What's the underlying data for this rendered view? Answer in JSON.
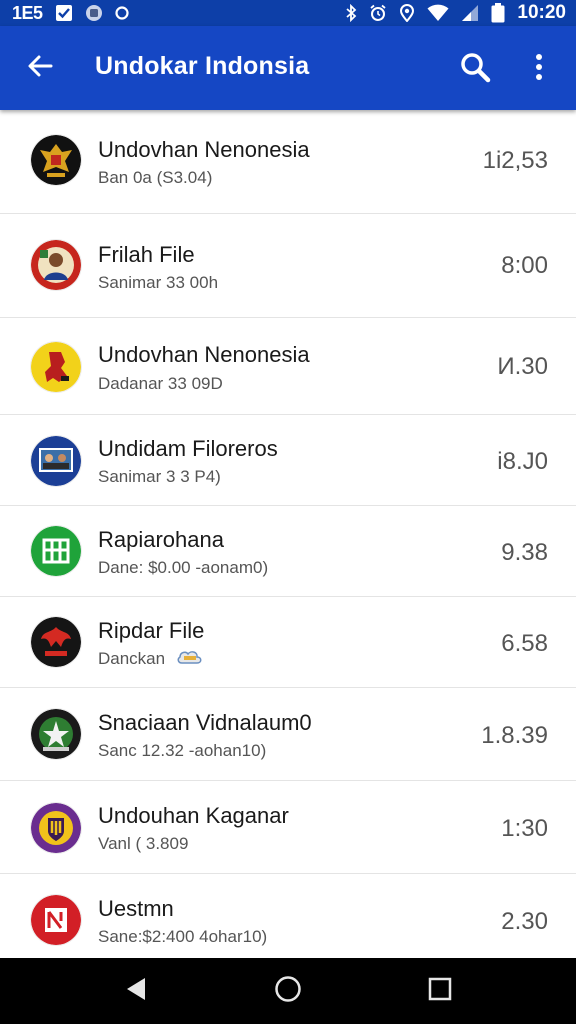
{
  "status_bar": {
    "left_time": "1E5",
    "clock": "10:20",
    "left_icons": [
      "checkbox-notification-icon",
      "app-notification-icon",
      "dot-notification-icon"
    ],
    "right_icons": [
      "bluetooth-icon",
      "alarm-icon",
      "location-icon",
      "wifi-icon",
      "signal-icon",
      "battery-icon"
    ]
  },
  "app_bar": {
    "title": "Undokar Indonsia",
    "back_icon": "arrow-back-icon",
    "search_icon": "search-icon",
    "more_icon": "more-vert-icon",
    "color": "#1547c4"
  },
  "list": {
    "items": [
      {
        "title": "Undovhan Nenonesia",
        "subtitle": "Ban 0a (S3.04)",
        "value": "1i2,53",
        "icon": "garuda-emblem-icon"
      },
      {
        "title": "Frilah File",
        "subtitle": "Sanimar 33 00h",
        "value": "8:00",
        "icon": "portrait-badge-icon"
      },
      {
        "title": "Undovhan Nenonesia",
        "subtitle": "Dadanar 33 09D",
        "value": "И.30",
        "icon": "yellow-emblem-icon"
      },
      {
        "title": "Undidam Filoreros",
        "subtitle": "Sanimar 3 3 P4)",
        "value": "i8.J0",
        "icon": "photo-thumbnail-icon"
      },
      {
        "title": "Rapiarohana",
        "subtitle": "Dane: $0.00 -aonam0)",
        "value": "9.38",
        "icon": "green-grid-icon"
      },
      {
        "title": "Ripdar File",
        "subtitle": "Danckan",
        "value": "6.58",
        "icon": "red-bird-emblem-icon",
        "subtitle_icon": "cloud-badge-icon"
      },
      {
        "title": "Snaciaan Vidnalaum0",
        "subtitle": "Sanc 12.32 -aohan10)",
        "value": "1.8.39",
        "icon": "leaf-emblem-icon"
      },
      {
        "title": "Undouhan Kaganar",
        "subtitle": "Vanl ( 3.809",
        "value": "1:30",
        "icon": "purple-shield-icon"
      },
      {
        "title": "Uestmn",
        "subtitle": "Sane:$2:400 4ohar10)",
        "value": "2.30",
        "icon": "red-app-logo-icon"
      }
    ]
  },
  "nav_bar": {
    "back_icon": "nav-back-icon",
    "home_icon": "nav-home-icon",
    "recents_icon": "nav-recents-icon"
  }
}
